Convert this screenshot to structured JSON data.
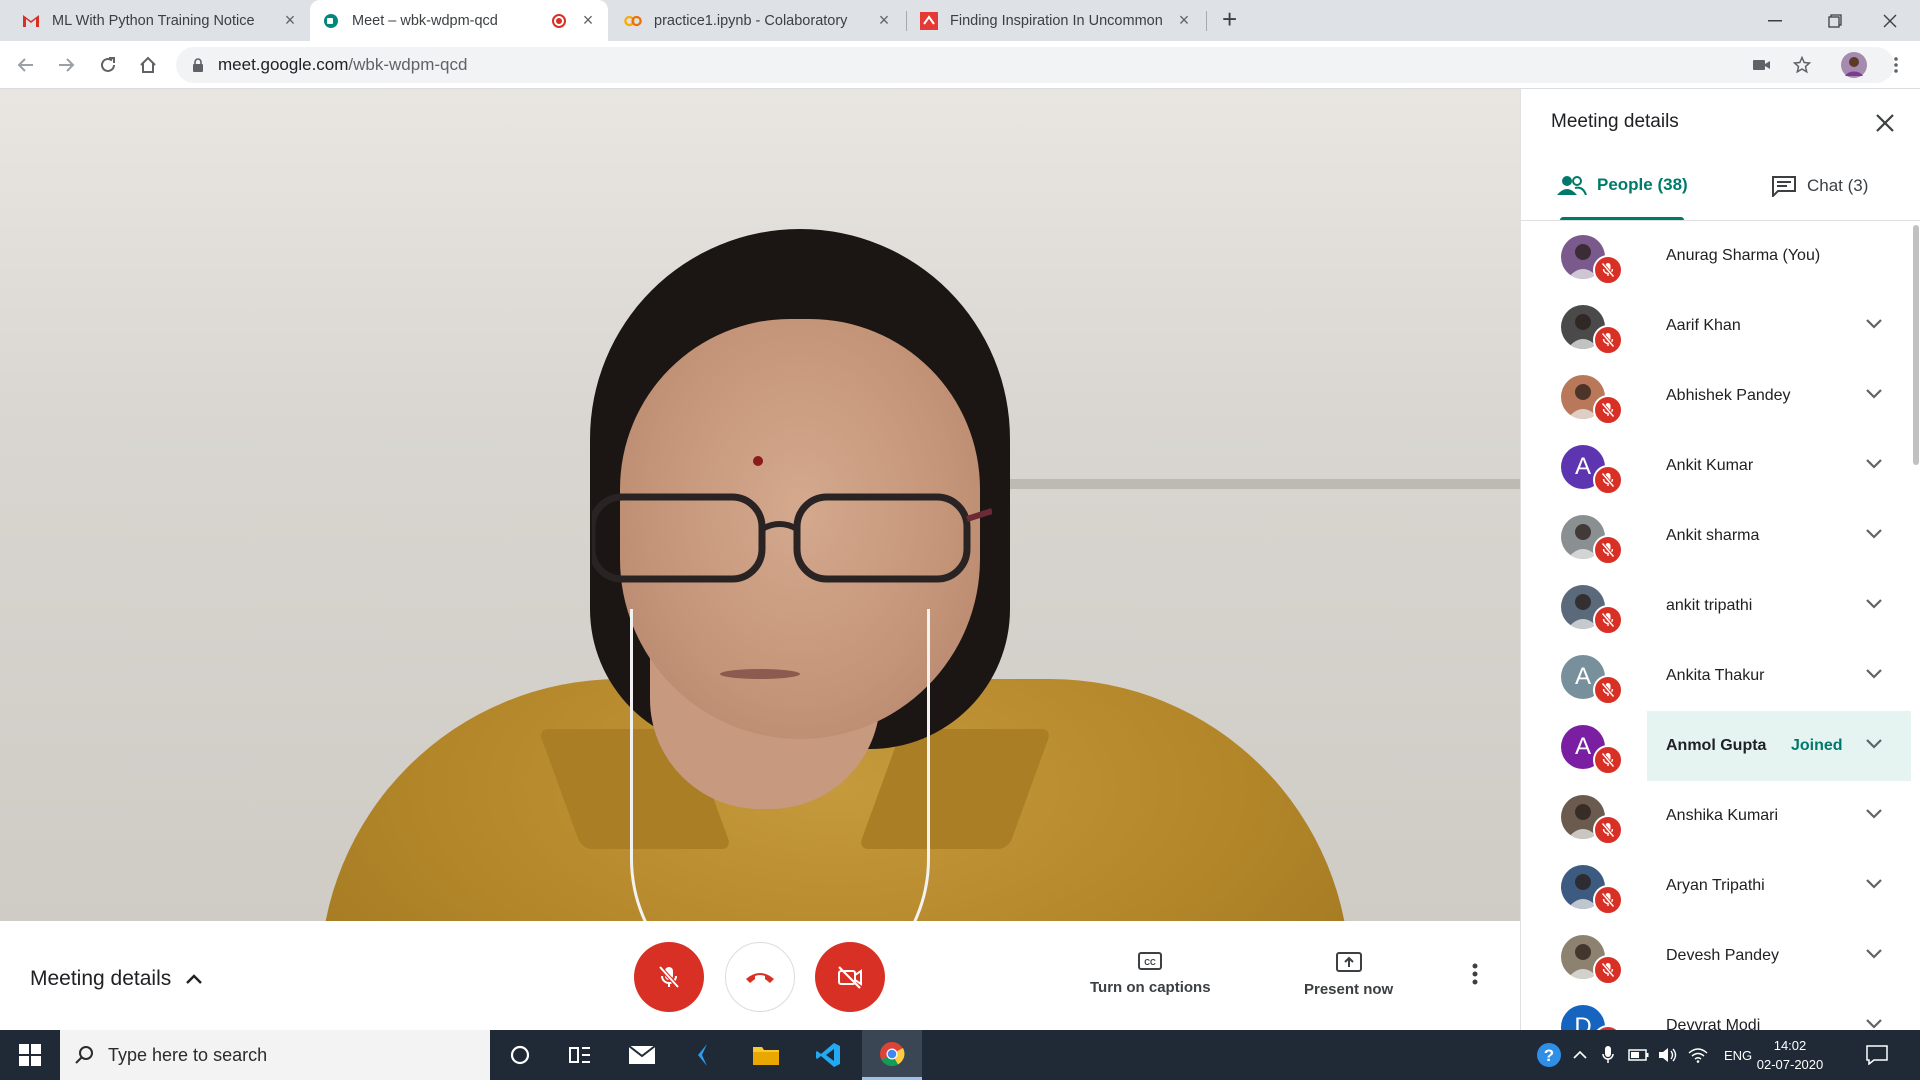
{
  "browser": {
    "tabs": [
      {
        "title": "ML With Python Training Notice",
        "active": false
      },
      {
        "title": "Meet – wbk-wdpm-qcd",
        "active": true,
        "recording": true
      },
      {
        "title": "practice1.ipynb - Colaboratory",
        "active": false
      },
      {
        "title": "Finding Inspiration In Uncommon",
        "active": false
      }
    ],
    "url_host": "meet.google.com",
    "url_path": "/wbk-wdpm-qcd"
  },
  "meeting": {
    "details_label": "Meeting details",
    "captions_label": "Turn on captions",
    "present_label": "Present now"
  },
  "panel": {
    "title": "Meeting details",
    "people_tab": "People (38)",
    "chat_tab": "Chat (3)",
    "people": [
      {
        "name": "Anurag Sharma (You)",
        "avatar": "photo",
        "color": "#7a5a8c",
        "expandable": false
      },
      {
        "name": "Aarif Khan",
        "avatar": "photo",
        "color": "#4a4a4a",
        "expandable": true
      },
      {
        "name": "Abhishek Pandey",
        "avatar": "photo",
        "color": "#b9785a",
        "expandable": true
      },
      {
        "name": "Ankit Kumar",
        "avatar": "A",
        "color": "#5e35b1",
        "expandable": true
      },
      {
        "name": "Ankit sharma",
        "avatar": "photo",
        "color": "#8a8f92",
        "expandable": true
      },
      {
        "name": "ankit tripathi",
        "avatar": "photo",
        "color": "#5a6a7a",
        "expandable": true
      },
      {
        "name": "Ankita Thakur",
        "avatar": "A",
        "color": "#78909c",
        "expandable": true
      },
      {
        "name": "Anmol Gupta",
        "avatar": "A",
        "color": "#7b1fa2",
        "expandable": true,
        "status": "Joined",
        "highlight": true
      },
      {
        "name": "Anshika Kumari",
        "avatar": "photo",
        "color": "#6a5b4e",
        "expandable": true
      },
      {
        "name": "Aryan Tripathi",
        "avatar": "photo",
        "color": "#3d5a80",
        "expandable": true
      },
      {
        "name": "Devesh Pandey",
        "avatar": "photo",
        "color": "#8d8270",
        "expandable": true
      },
      {
        "name": "Devvrat Modi",
        "avatar": "D",
        "color": "#1565c0",
        "expandable": true
      }
    ]
  },
  "taskbar": {
    "search_placeholder": "Type here to search",
    "lang": "ENG",
    "time": "14:02",
    "date": "02-07-2020"
  }
}
